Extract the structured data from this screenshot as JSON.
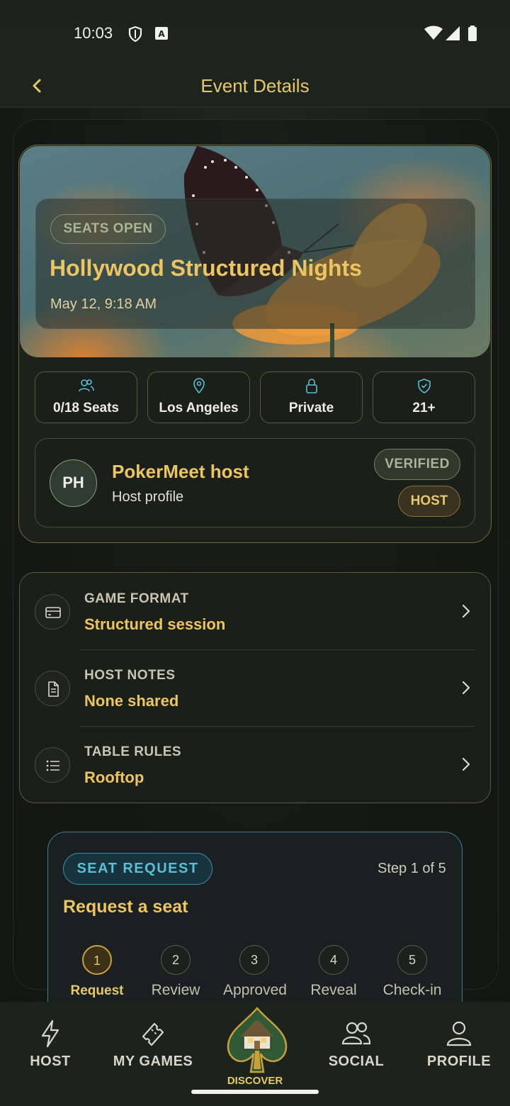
{
  "status_bar": {
    "time": "10:03"
  },
  "appbar": {
    "title": "Event Details"
  },
  "event": {
    "status_badge": "SEATS OPEN",
    "title": "Hollywood Structured Nights",
    "datetime": "May 12, 9:18 AM"
  },
  "chips": [
    {
      "icon": "people-icon",
      "label": "0/18 Seats"
    },
    {
      "icon": "location-pin-icon",
      "label": "Los Angeles"
    },
    {
      "icon": "lock-icon",
      "label": "Private"
    },
    {
      "icon": "shield-check-icon",
      "label": "21+"
    }
  ],
  "host": {
    "initials": "PH",
    "name": "PokerMeet host",
    "subtitle": "Host profile",
    "verified_badge": "VERIFIED",
    "host_badge": "HOST"
  },
  "details": [
    {
      "icon": "card-icon",
      "label": "GAME FORMAT",
      "value": "Structured session"
    },
    {
      "icon": "document-icon",
      "label": "HOST NOTES",
      "value": "None shared"
    },
    {
      "icon": "list-icon",
      "label": "TABLE RULES",
      "value": "Rooftop"
    }
  ],
  "seat_request": {
    "badge": "SEAT REQUEST",
    "step_text": "Step 1 of 5",
    "title": "Request a seat",
    "current_step": 1,
    "steps": [
      {
        "number": "1",
        "label": "Request"
      },
      {
        "number": "2",
        "label": "Review"
      },
      {
        "number": "3",
        "label": "Approved"
      },
      {
        "number": "4",
        "label": "Reveal"
      },
      {
        "number": "5",
        "label": "Check-in"
      }
    ]
  },
  "bottom_nav": {
    "items": [
      {
        "icon": "lightning-icon",
        "label": "HOST"
      },
      {
        "icon": "ticket-icon",
        "label": "MY GAMES"
      },
      {
        "icon": "house-spade-icon",
        "label": "DISCOVER",
        "active": true
      },
      {
        "icon": "people-icon",
        "label": "SOCIAL"
      },
      {
        "icon": "person-icon",
        "label": "PROFILE"
      }
    ]
  },
  "colors": {
    "accent_gold": "#ecc560",
    "accent_teal": "#59bfd9",
    "background": "#171b17"
  }
}
